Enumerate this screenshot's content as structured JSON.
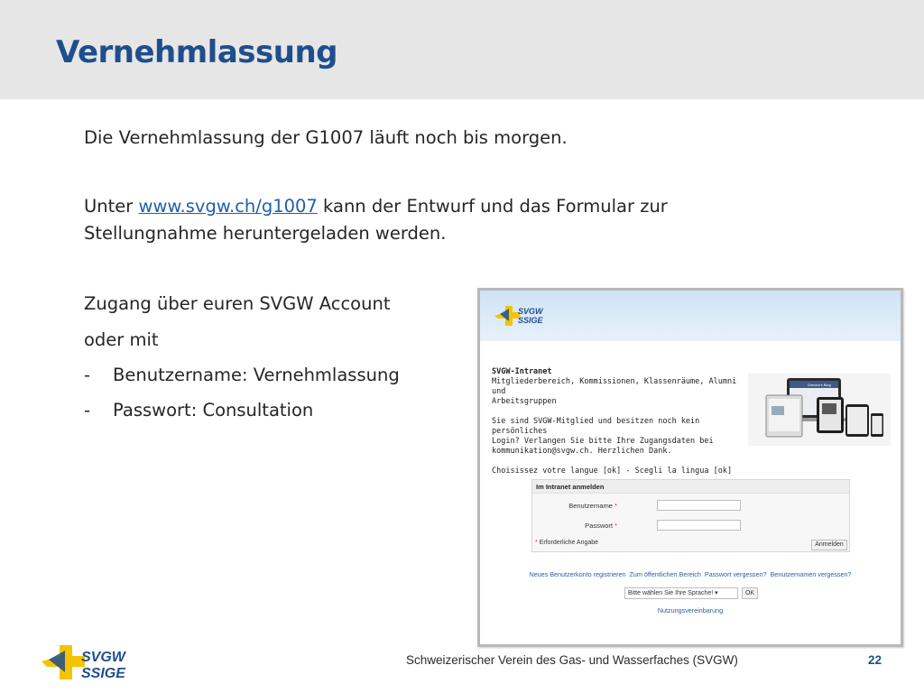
{
  "slide": {
    "title": "Vernehmlassung",
    "line1": "Die Vernehmlassung der G1007 läuft noch bis morgen.",
    "line2_pre": "Unter ",
    "line2_link": "www.svgw.ch/g1007",
    "line2_post": " kann der Entwurf und das Formular zur",
    "line3": "Stellungnahme heruntergeladen werden.",
    "line4": "Zugang über euren SVGW Account",
    "line5": "oder mit",
    "bullet_dash": "-",
    "bullet1": "Benutzername: Vernehmlassung",
    "bullet2": "Passwort: Consultation"
  },
  "screenshot": {
    "logo_top": "SVGW",
    "logo_bottom": "SSIGE",
    "intranet_title": "SVGW-Intranet",
    "intranet_lines": [
      "Mitgliederbereich, Kommissionen, Klassenräume, Alumni und",
      "Arbeitsgruppen"
    ],
    "intranet_info": [
      "Sie sind SVGW-Mitglied und besitzen noch kein persönliches",
      "Login? Verlangen Sie bitte Ihre Zugangsdaten bei",
      "kommunikation@svgw.ch. Herzlichen Dank."
    ],
    "language_line": "Choisissez votre langue [ok] - Scegli la lingua [ok]",
    "device_caption": "Director's Blog",
    "login_title": "Im Intranet anmelden",
    "username_label": "Benutzername",
    "password_label": "Passwort",
    "required_star": "*",
    "required_note": "Erforderliche Angabe",
    "login_button": "Anmelden",
    "links": [
      "Neues Benutzerkonto registrieren",
      "Zum öffentlichen Bereich",
      "Passwort vergessen?",
      "Benutzernamen vergessen?"
    ],
    "language_select": "Bitte wählen Sie Ihre Sprache!",
    "ok_button": "OK",
    "terms_link": "Nutzungsvereinbarung"
  },
  "footer": {
    "logo_top": "SVGW",
    "logo_bottom": "SSIGE",
    "text": "Schweizerischer Verein des Gas- und Wasserfaches (SVGW)",
    "page": "22"
  },
  "colors": {
    "brand_blue": "#1f4e8c",
    "brand_yellow": "#f5c400",
    "link": "#1f5fa8"
  }
}
